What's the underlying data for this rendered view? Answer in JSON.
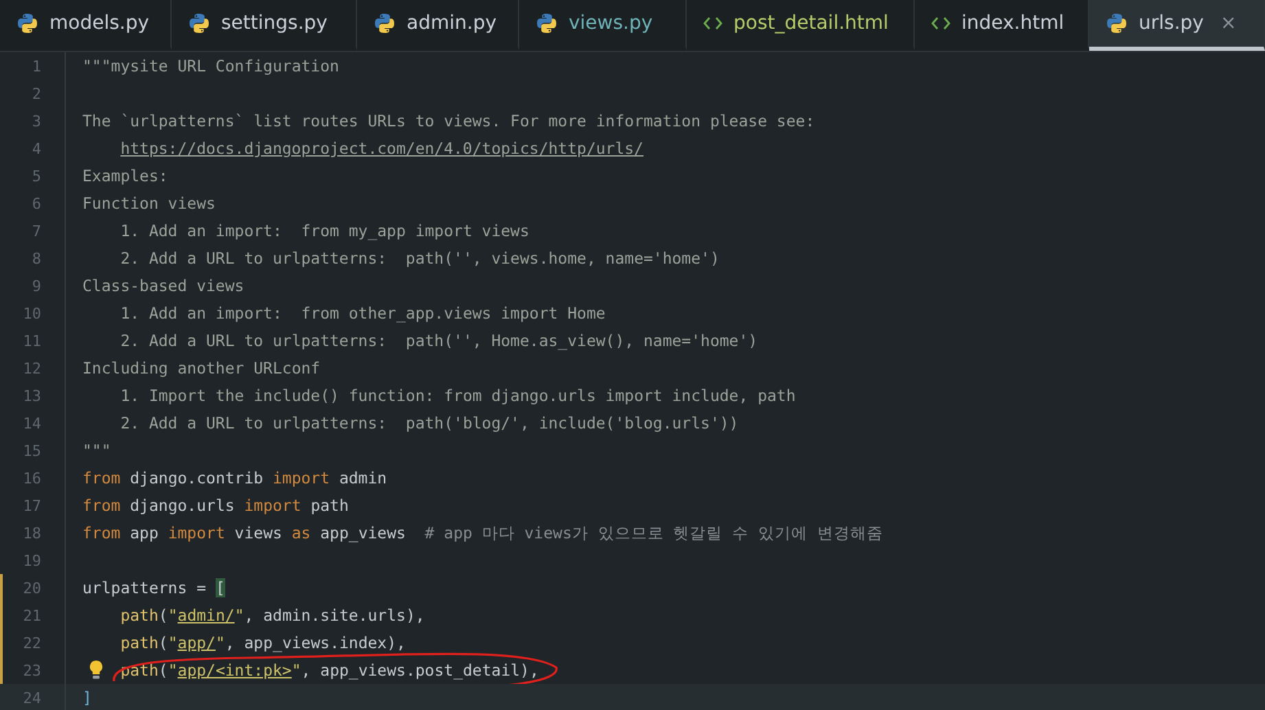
{
  "tabs": [
    {
      "label": "models.py",
      "kind": "python",
      "selected": false,
      "color": "#c9d1d9"
    },
    {
      "label": "settings.py",
      "kind": "python",
      "selected": false,
      "color": "#c9d1d9"
    },
    {
      "label": "admin.py",
      "kind": "python",
      "selected": false,
      "color": "#c9d1d9"
    },
    {
      "label": "views.py",
      "kind": "python",
      "selected": false,
      "color": "#6fb3b8"
    },
    {
      "label": "post_detail.html",
      "kind": "html",
      "selected": false,
      "color": "#b5cc6a"
    },
    {
      "label": "index.html",
      "kind": "html",
      "selected": false,
      "color": "#c9d1d9"
    },
    {
      "label": "urls.py",
      "kind": "python",
      "selected": true,
      "color": "#c9d1d9",
      "close": "×"
    }
  ],
  "lines": [
    {
      "number": "1",
      "segments": [
        {
          "kind": "doc",
          "text": "\"\"\"mysite URL Configuration"
        }
      ]
    },
    {
      "number": "2"
    },
    {
      "number": "3",
      "segments": [
        {
          "kind": "doc",
          "text": "The `urlpatterns` list routes URLs to views. For more information please see:"
        }
      ]
    },
    {
      "number": "4",
      "indented": true,
      "segments": [
        {
          "kind": "doclink",
          "text": "https://docs.djangoproject.com/en/4.0/topics/http/urls/"
        }
      ]
    },
    {
      "number": "5",
      "segments": [
        {
          "kind": "doc",
          "text": "Examples:"
        }
      ]
    },
    {
      "number": "6",
      "segments": [
        {
          "kind": "doc",
          "text": "Function views"
        }
      ]
    },
    {
      "number": "7",
      "segments": [
        {
          "kind": "doc",
          "text": "    1. Add an import:  from my_app import views"
        }
      ]
    },
    {
      "number": "8",
      "segments": [
        {
          "kind": "doc",
          "text": "    2. Add a URL to urlpatterns:  path('', views.home, name='home')"
        }
      ]
    },
    {
      "number": "9",
      "segments": [
        {
          "kind": "doc",
          "text": "Class-based views"
        }
      ]
    },
    {
      "number": "10",
      "segments": [
        {
          "kind": "doc",
          "text": "    1. Add an import:  from other_app.views import Home"
        }
      ]
    },
    {
      "number": "11",
      "segments": [
        {
          "kind": "doc",
          "text": "    2. Add a URL to urlpatterns:  path('', Home.as_view(), name='home')"
        }
      ]
    },
    {
      "number": "12",
      "segments": [
        {
          "kind": "doc",
          "text": "Including another URLconf"
        }
      ]
    },
    {
      "number": "13",
      "segments": [
        {
          "kind": "doc",
          "text": "    1. Import the include() function: from django.urls import include, path"
        }
      ]
    },
    {
      "number": "14",
      "segments": [
        {
          "kind": "doc",
          "text": "    2. Add a URL to urlpatterns:  path('blog/', include('blog.urls'))"
        }
      ]
    },
    {
      "number": "15",
      "segments": [
        {
          "kind": "doc",
          "text": "\"\"\""
        }
      ]
    },
    {
      "number": "16",
      "segments": [
        {
          "kind": "kw",
          "text": "from"
        },
        {
          "kind": "plain",
          "text": " django.contrib "
        },
        {
          "kind": "kw",
          "text": "import"
        },
        {
          "kind": "plain",
          "text": " admin"
        }
      ]
    },
    {
      "number": "17",
      "segments": [
        {
          "kind": "kw",
          "text": "from"
        },
        {
          "kind": "plain",
          "text": " django.urls "
        },
        {
          "kind": "kw",
          "text": "import"
        },
        {
          "kind": "plain",
          "text": " path"
        }
      ]
    },
    {
      "number": "18",
      "segments": [
        {
          "kind": "kw",
          "text": "from"
        },
        {
          "kind": "plain",
          "text": " app "
        },
        {
          "kind": "kw",
          "text": "import"
        },
        {
          "kind": "plain",
          "text": " views "
        },
        {
          "kind": "kw",
          "text": "as"
        },
        {
          "kind": "plain",
          "text": " app_views  "
        },
        {
          "kind": "comment",
          "text": "# app 마다 views가 있으므로 헷갈릴 수 있기에 변경해줌"
        }
      ]
    },
    {
      "number": "19"
    },
    {
      "number": "20",
      "changed": true,
      "segments": [
        {
          "kind": "plain",
          "text": "urlpatterns = "
        },
        {
          "kind": "bracket",
          "text": "["
        }
      ]
    },
    {
      "number": "21",
      "changed": true,
      "indented": true,
      "segments": [
        {
          "kind": "func",
          "text": "path"
        },
        {
          "kind": "plain",
          "text": "("
        },
        {
          "kind": "str",
          "text": "\""
        },
        {
          "kind": "strlink",
          "text": "admin/"
        },
        {
          "kind": "str",
          "text": "\""
        },
        {
          "kind": "plain",
          "text": ", admin.site.urls),"
        }
      ]
    },
    {
      "number": "22",
      "changed": true,
      "indented": true,
      "segments": [
        {
          "kind": "func",
          "text": "path"
        },
        {
          "kind": "plain",
          "text": "("
        },
        {
          "kind": "str",
          "text": "\""
        },
        {
          "kind": "strlink",
          "text": "app/"
        },
        {
          "kind": "str",
          "text": "\""
        },
        {
          "kind": "plain",
          "text": ", app_views.index),"
        }
      ]
    },
    {
      "number": "23",
      "changed": true,
      "indented": true,
      "hint": true,
      "circled": true,
      "segments": [
        {
          "kind": "func",
          "text": "path"
        },
        {
          "kind": "plain",
          "text": "("
        },
        {
          "kind": "str",
          "text": "\""
        },
        {
          "kind": "strlink",
          "text": "app/<int:pk>"
        },
        {
          "kind": "str",
          "text": "\""
        },
        {
          "kind": "plain",
          "text": ", app_views.post_detail),"
        }
      ]
    },
    {
      "number": "24",
      "current": true,
      "segments": [
        {
          "kind": "bracket",
          "text": "]"
        }
      ]
    }
  ]
}
